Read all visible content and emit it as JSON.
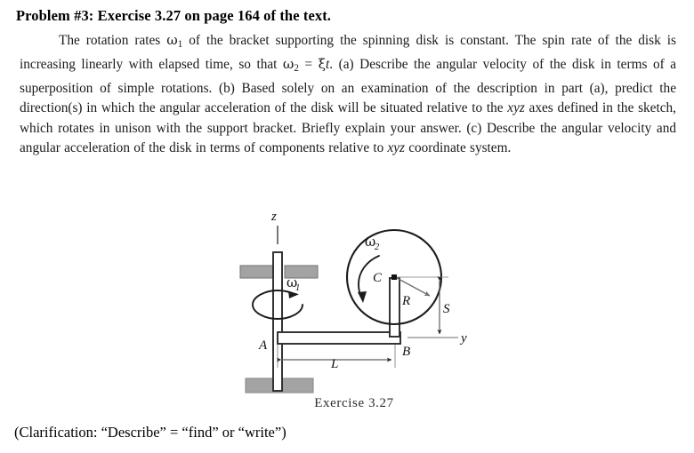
{
  "document": {
    "title": "Problem #3: Exercise 3.27 on page 164 of the text.",
    "paragraph_runs": [
      {
        "t": "text",
        "v": "The rotation rates "
      },
      {
        "t": "greek",
        "v": "ω"
      },
      {
        "t": "sub",
        "v": "1"
      },
      {
        "t": "text",
        "v": " of the bracket supporting the spinning disk is constant. The spin rate of the disk is increasing linearly with elapsed time, so that "
      },
      {
        "t": "greek",
        "v": "ω"
      },
      {
        "t": "sub",
        "v": "2"
      },
      {
        "t": "text",
        "v": " = "
      },
      {
        "t": "greek",
        "v": "ξ"
      },
      {
        "t": "italic",
        "v": "t"
      },
      {
        "t": "text",
        "v": ". (a) Describe the angular velocity of the disk in terms of a superposition of simple rotations. (b) Based solely on an examination of the description in part (a), predict the direction(s) in which the angular acceleration of the disk will be situated relative to the "
      },
      {
        "t": "italic",
        "v": "xyz"
      },
      {
        "t": "text",
        "v": " axes defined in the sketch, which rotates in unison with the support bracket. Briefly explain your answer. (c) Describe the angular velocity and angular acceleration of the disk in terms of components relative to "
      },
      {
        "t": "italic",
        "v": "xyz"
      },
      {
        "t": "text",
        "v": " coordinate system."
      }
    ],
    "paragraph_plain": "The rotation rates ω₁ of the bracket supporting the spinning disk is constant. The spin rate of the disk is increasing linearly with elapsed time, so that ω₂ = ξt. (a) Describe the angular velocity of the disk in terms of a superposition of simple rotations. (b) Based solely on an examination of the description in part (a), predict the direction(s) in which the angular acceleration of the disk will be situated relative to the xyz axes defined in the sketch, which rotates in unison with the support bracket. Briefly explain your answer. (c) Describe the angular velocity and angular acceleration of the disk in terms of components relative to xyz coordinate system.",
    "clarification": "(Clarification: “Describe” = “find” or “write”)"
  },
  "figure": {
    "caption": "Exercise 3.27",
    "labels": {
      "axis_z": "z",
      "axis_y": "y",
      "omega_1_symbol": "ω",
      "omega_1_sub": "1",
      "omega_2_symbol": "ω",
      "omega_2_sub": "2",
      "point_a": "A",
      "point_b": "B",
      "point_c": "C",
      "radius": "R",
      "length": "L",
      "offset": "S"
    },
    "colors": {
      "ink": "#111111",
      "outline": "#2b2b2b",
      "block_fill": "#a0a0a0",
      "block_stroke": "#777777",
      "dimension_line": "#8a8a8a",
      "background": "#ffffff"
    }
  }
}
